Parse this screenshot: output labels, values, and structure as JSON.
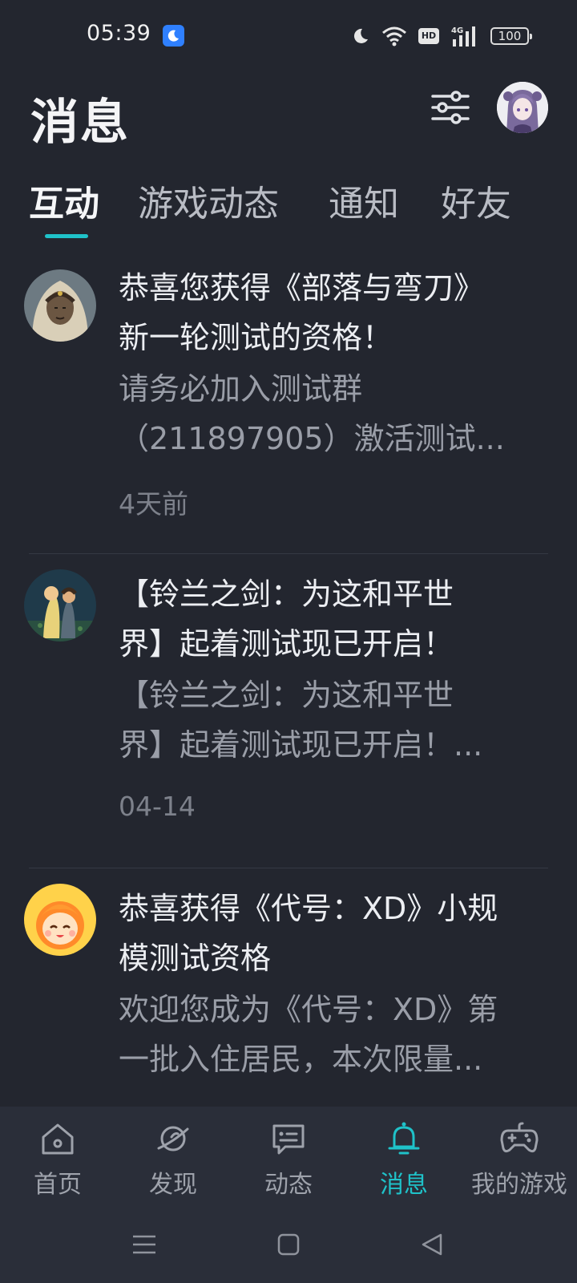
{
  "status_bar": {
    "time": "05:39",
    "battery": "100",
    "network": "4G",
    "hd": "HD"
  },
  "header": {
    "title": "消息"
  },
  "tabs": [
    {
      "label": "互动",
      "active": true
    },
    {
      "label": "游戏动态",
      "active": false
    },
    {
      "label": "通知",
      "active": false
    },
    {
      "label": "好友",
      "active": false
    }
  ],
  "messages": [
    {
      "title": "恭喜您获得《部落与弯刀》新一轮测试的资格！",
      "title_lines": [
        "恭喜您获得《部落与弯刀》",
        "新一轮测试的资格！"
      ],
      "body_lines": [
        "请务必加入测试群",
        "（211897905）激活测试..."
      ],
      "time": "4天前"
    },
    {
      "title": "【铃兰之剑：为这和平世界】起着测试现已开启！",
      "title_lines": [
        "【铃兰之剑：为这和平世",
        "界】起着测试现已开启！"
      ],
      "body_lines": [
        "【铃兰之剑：为这和平世",
        "界】起着测试现已开启！..."
      ],
      "time": "04-14"
    },
    {
      "title": "恭喜获得《代号：XD》小规模测试资格",
      "title_lines": [
        "恭喜获得《代号：XD》小规",
        "模测试资格"
      ],
      "body_lines": [
        "欢迎您成为《代号：XD》第",
        "一批入住居民，本次限量..."
      ],
      "time": ""
    }
  ],
  "bottom_nav": [
    {
      "label": "首页",
      "icon": "home-icon",
      "active": false
    },
    {
      "label": "发现",
      "icon": "planet-icon",
      "active": false
    },
    {
      "label": "动态",
      "icon": "chat-card-icon",
      "active": false
    },
    {
      "label": "消息",
      "icon": "bell-icon",
      "active": true
    },
    {
      "label": "我的游戏",
      "icon": "gamepad-icon",
      "active": false
    }
  ],
  "colors": {
    "background": "#23262f",
    "accent": "#1fc2c9",
    "nav_background": "#2a2e39"
  }
}
